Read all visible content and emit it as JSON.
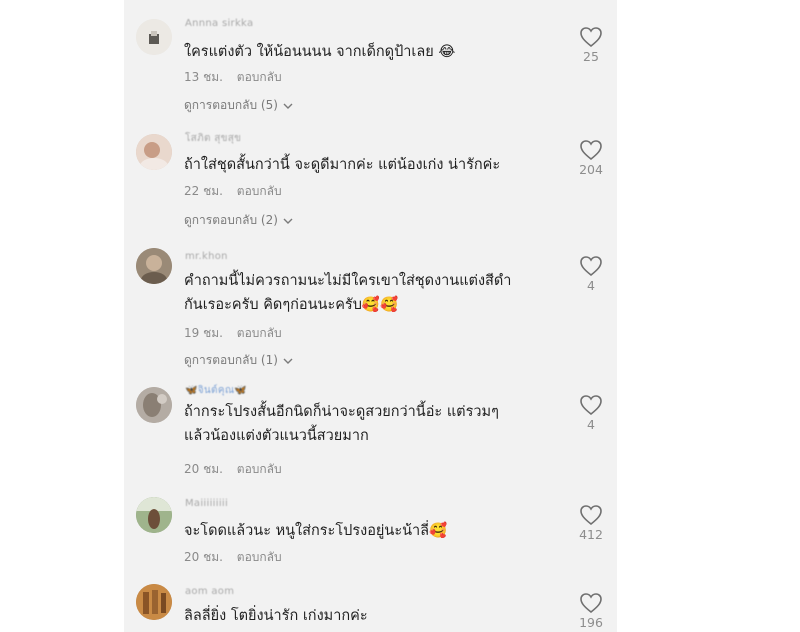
{
  "comments": [
    {
      "username": "Annna sirkka",
      "text": [
        "ใครแต่งตัว ให้น้อนนนน จากเด็กดูป้าเลย 😂"
      ],
      "time": "13 ชม.",
      "reply": "ตอบกลับ",
      "view_replies": "ดูการตอบกลับ (5)",
      "likes": "25",
      "avatar_color": "#d9d6cf"
    },
    {
      "username": "โสภิต สุขสุข",
      "text": [
        "ถ้าใส่ชุดสั้นกว่านี้ จะดูดีมากค่ะ แต่น้องเก่ง น่ารักค่ะ"
      ],
      "time": "22 ชม.",
      "reply": "ตอบกลับ",
      "view_replies": "ดูการตอบกลับ (2)",
      "likes": "204",
      "avatar_color": "#c9a99a"
    },
    {
      "username": "mr.khon",
      "text": [
        "คำถามนี้ไม่ควรถามนะไม่มีใครเขาใส่ชุดงานแต่งสีดำ",
        "กันเรอะครับ คิดๆก่อนนะครับ🥰🥰"
      ],
      "time": "19 ชม.",
      "reply": "ตอบกลับ",
      "view_replies": "ดูการตอบกลับ (1)",
      "likes": "4",
      "avatar_color": "#8e7f6d"
    },
    {
      "username": "🦋จินต์คุณ🦋",
      "text": [
        "ถ้ากระโปรงสั้นอีกนิดก็น่าจะดูสวยกว่านี้อ่ะ แต่รวมๆ",
        "แล้วน้องแต่งตัวแนวนี้สวยมาก"
      ],
      "time": "20 ชม.",
      "reply": "ตอบกลับ",
      "view_replies": "",
      "likes": "4",
      "avatar_color": "#a9a19a"
    },
    {
      "username": "Maiiiiiiiii",
      "text": [
        "จะโดดแล้วนะ หนูใส่กระโปรงอยู่นะน้าลี่🥰"
      ],
      "time": "20 ชม.",
      "reply": "ตอบกลับ",
      "view_replies": "",
      "likes": "412",
      "avatar_color": "#7f9a6e"
    },
    {
      "username": "aom aom",
      "text": [
        "ลิลลี่ยิ่ง โตยิ่งน่ารัก เก่งมากค่ะ"
      ],
      "time": "",
      "reply": "",
      "view_replies": "",
      "likes": "196",
      "avatar_color": "#b5793c"
    }
  ],
  "icons": {
    "like": "heart-outline-icon",
    "chevron": "chevron-down-icon"
  },
  "colors": {
    "panel_bg": "#f2f2f2",
    "text": "#1e1e1e",
    "muted": "#8a8a8a"
  }
}
